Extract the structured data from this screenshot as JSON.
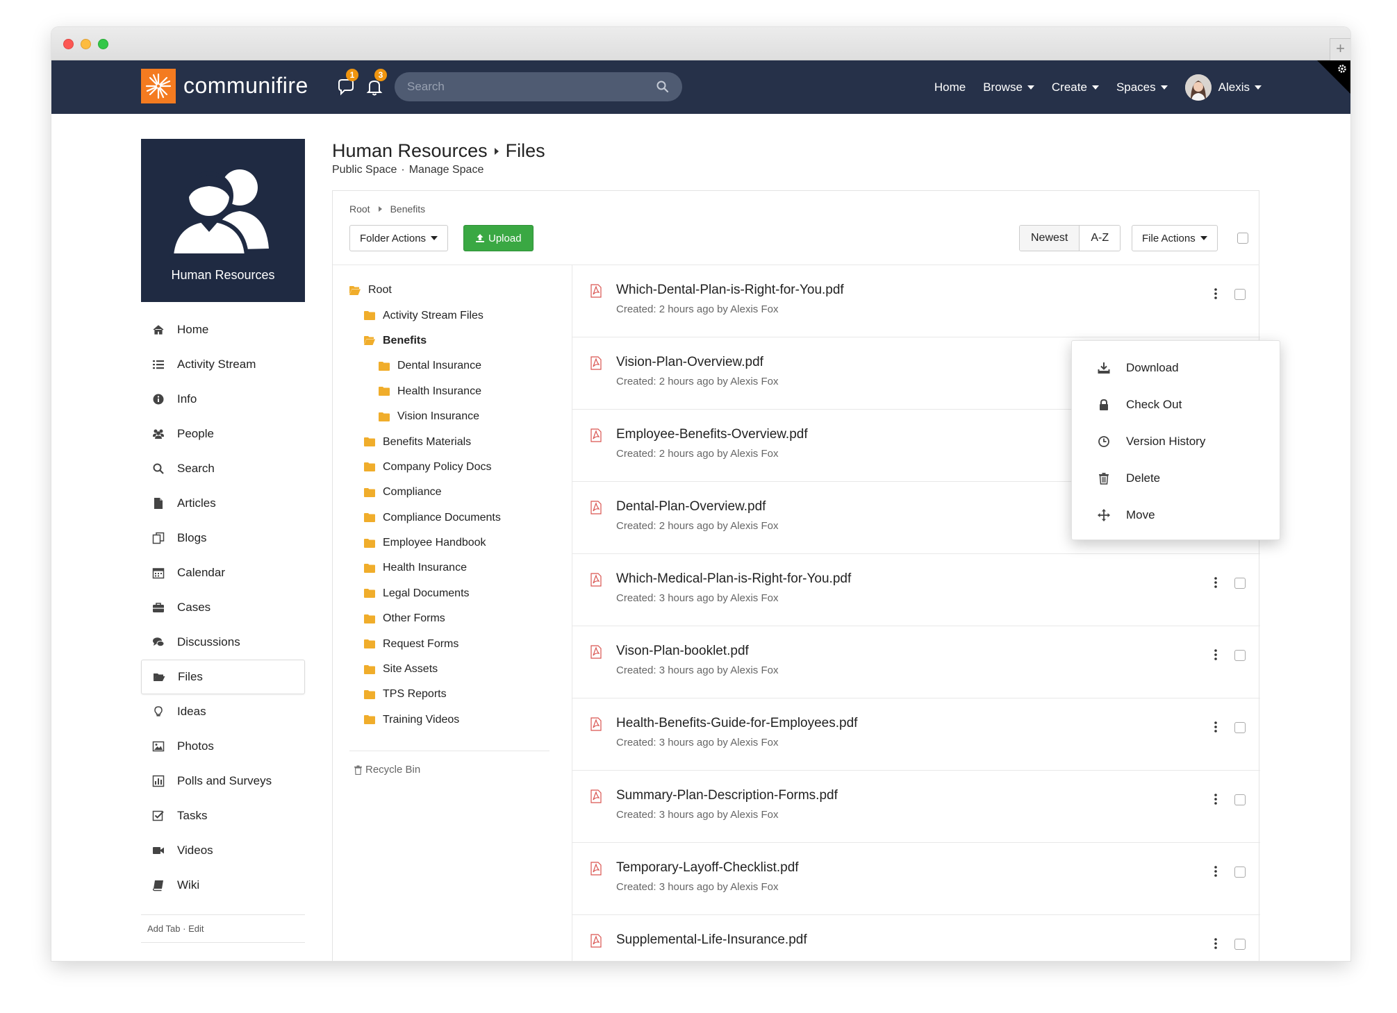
{
  "brand": {
    "name": "communifire",
    "accent": "#f47b20",
    "navbar_bg": "#263149"
  },
  "header": {
    "messages_badge": "1",
    "notifications_badge": "3",
    "search_placeholder": "Search",
    "nav": [
      {
        "label": "Home"
      },
      {
        "label": "Browse"
      },
      {
        "label": "Create"
      },
      {
        "label": "Spaces"
      }
    ],
    "user_name": "Alexis"
  },
  "space": {
    "name": "Human Resources"
  },
  "sidebar": {
    "items": [
      {
        "label": "Home",
        "icon": "home-icon"
      },
      {
        "label": "Activity Stream",
        "icon": "list-icon"
      },
      {
        "label": "Info",
        "icon": "info-icon"
      },
      {
        "label": "People",
        "icon": "people-icon"
      },
      {
        "label": "Search",
        "icon": "search-icon"
      },
      {
        "label": "Articles",
        "icon": "article-icon"
      },
      {
        "label": "Blogs",
        "icon": "blog-icon"
      },
      {
        "label": "Calendar",
        "icon": "calendar-icon"
      },
      {
        "label": "Cases",
        "icon": "briefcase-icon"
      },
      {
        "label": "Discussions",
        "icon": "chat-icon"
      },
      {
        "label": "Files",
        "icon": "folder-open-icon",
        "active": true
      },
      {
        "label": "Ideas",
        "icon": "lightbulb-icon"
      },
      {
        "label": "Photos",
        "icon": "photo-icon"
      },
      {
        "label": "Polls and Surveys",
        "icon": "poll-icon"
      },
      {
        "label": "Tasks",
        "icon": "task-icon"
      },
      {
        "label": "Videos",
        "icon": "video-icon"
      },
      {
        "label": "Wiki",
        "icon": "book-icon"
      }
    ],
    "footer_add_tab": "Add Tab",
    "footer_sep": "·",
    "footer_edit": "Edit"
  },
  "page": {
    "space_title": "Human Resources",
    "section_title": "Files",
    "sub_public": "Public Space",
    "sub_sep": "·",
    "sub_manage": "Manage Space"
  },
  "panel": {
    "breadcrumb": [
      "Root",
      "Benefits"
    ],
    "folder_actions": "Folder Actions",
    "upload": "Upload",
    "sort_newest": "Newest",
    "sort_az": "A-Z",
    "file_actions": "File Actions",
    "recycle_bin": "Recycle Bin"
  },
  "tree": [
    {
      "label": "Root",
      "level": 0,
      "open": true
    },
    {
      "label": "Activity Stream Files",
      "level": 1
    },
    {
      "label": "Benefits",
      "level": 1,
      "open": true,
      "bold": true
    },
    {
      "label": "Dental Insurance",
      "level": 2
    },
    {
      "label": "Health Insurance",
      "level": 2
    },
    {
      "label": "Vision Insurance",
      "level": 2
    },
    {
      "label": "Benefits Materials",
      "level": 1
    },
    {
      "label": "Company Policy Docs",
      "level": 1
    },
    {
      "label": "Compliance",
      "level": 1
    },
    {
      "label": "Compliance Documents",
      "level": 1
    },
    {
      "label": "Employee Handbook",
      "level": 1
    },
    {
      "label": "Health Insurance",
      "level": 1
    },
    {
      "label": "Legal Documents",
      "level": 1
    },
    {
      "label": "Other Forms",
      "level": 1
    },
    {
      "label": "Request Forms",
      "level": 1
    },
    {
      "label": "Site Assets",
      "level": 1
    },
    {
      "label": "TPS Reports",
      "level": 1
    },
    {
      "label": "Training Videos",
      "level": 1
    }
  ],
  "files": [
    {
      "name": "Which-Dental-Plan-is-Right-for-You.pdf",
      "meta": "Created: 2 hours ago by Alexis Fox"
    },
    {
      "name": "Vision-Plan-Overview.pdf",
      "meta": "Created: 2 hours ago by Alexis Fox"
    },
    {
      "name": "Employee-Benefits-Overview.pdf",
      "meta": "Created: 2 hours ago by Alexis Fox"
    },
    {
      "name": "Dental-Plan-Overview.pdf",
      "meta": "Created: 2 hours ago by Alexis Fox"
    },
    {
      "name": "Which-Medical-Plan-is-Right-for-You.pdf",
      "meta": "Created: 3 hours ago by Alexis Fox"
    },
    {
      "name": "Vison-Plan-booklet.pdf",
      "meta": "Created: 3 hours ago by Alexis Fox"
    },
    {
      "name": "Health-Benefits-Guide-for-Employees.pdf",
      "meta": "Created: 3 hours ago by Alexis Fox"
    },
    {
      "name": "Summary-Plan-Description-Forms.pdf",
      "meta": "Created: 3 hours ago by Alexis Fox"
    },
    {
      "name": "Temporary-Layoff-Checklist.pdf",
      "meta": "Created: 3 hours ago by Alexis Fox"
    },
    {
      "name": "Supplemental-Life-Insurance.pdf",
      "meta": ""
    }
  ],
  "file_menu": [
    {
      "label": "Download",
      "icon": "download-icon"
    },
    {
      "label": "Check Out",
      "icon": "lock-icon"
    },
    {
      "label": "Version History",
      "icon": "clock-icon"
    },
    {
      "label": "Delete",
      "icon": "trash-icon"
    },
    {
      "label": "Move",
      "icon": "move-icon"
    }
  ]
}
